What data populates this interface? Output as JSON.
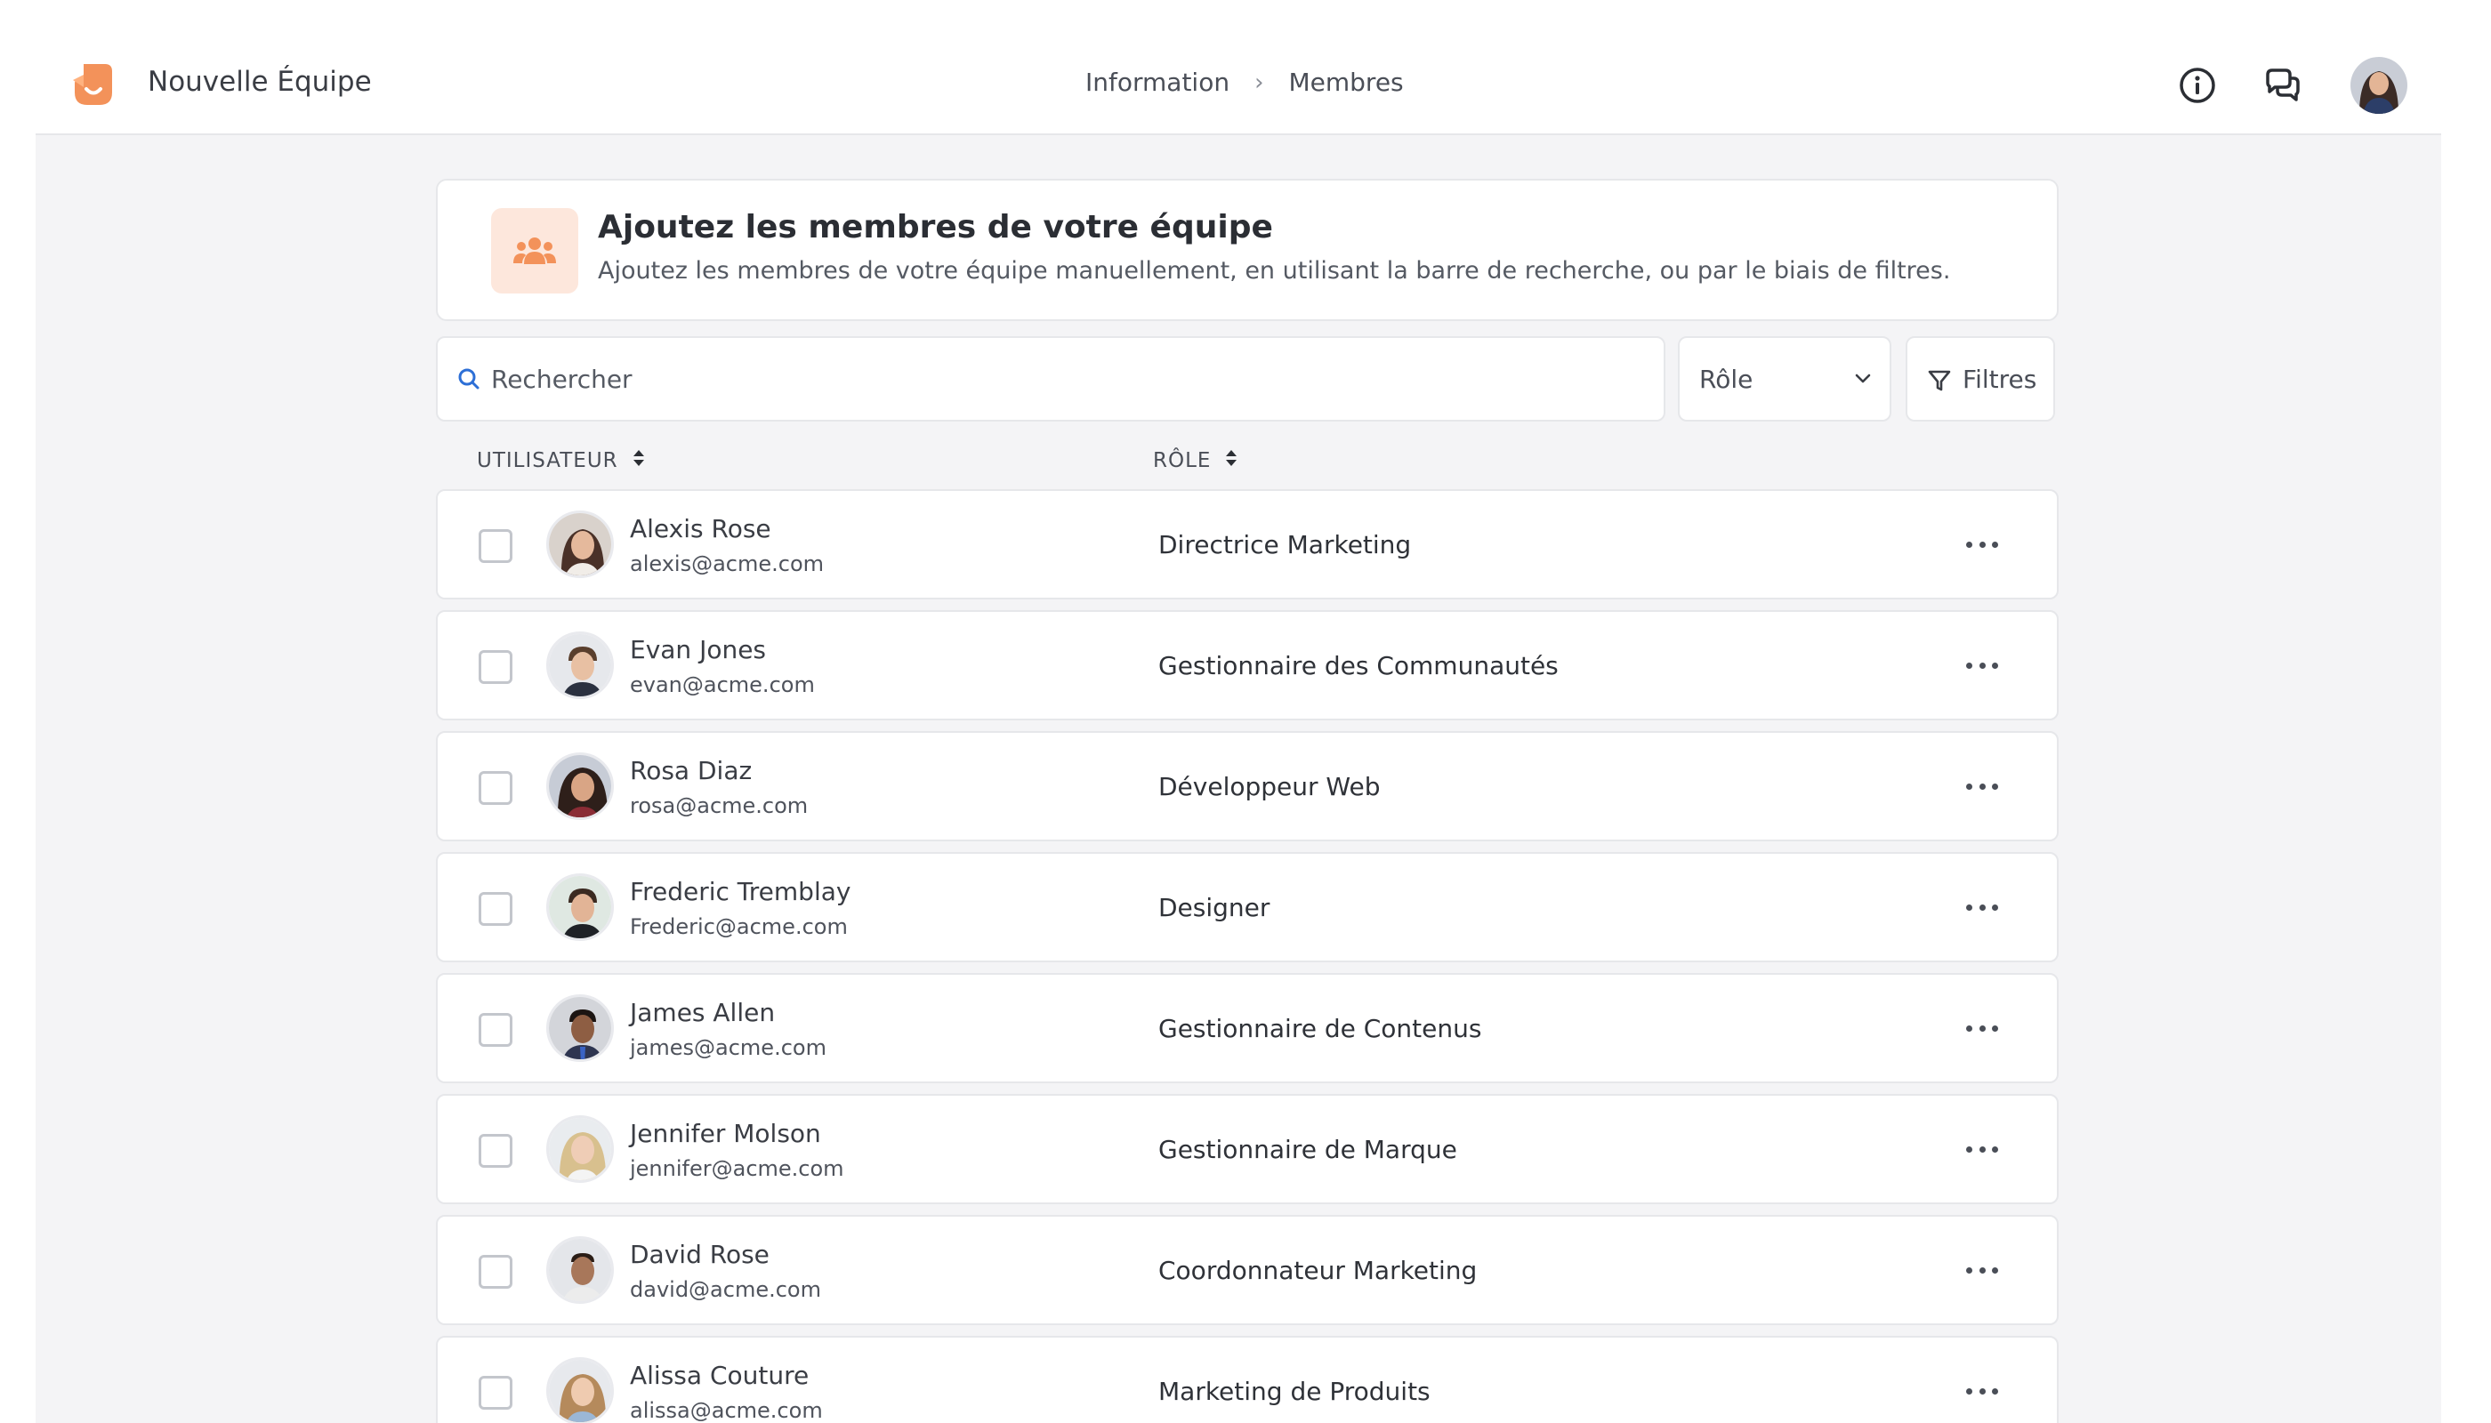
{
  "header": {
    "team_name": "Nouvelle Équipe",
    "breadcrumb": [
      "Information",
      "Membres"
    ],
    "icons": [
      "info-icon",
      "chat-icon",
      "user-avatar"
    ]
  },
  "intro": {
    "icon": "team-icon",
    "title": "Ajoutez les membres de votre équipe",
    "subtitle": "Ajoutez les membres de votre équipe manuellement, en utilisant la barre de recherche, ou par le biais de filtres."
  },
  "search": {
    "placeholder": "Rechercher"
  },
  "role_filter": {
    "label": "Rôle"
  },
  "filters": {
    "label": "Filtres"
  },
  "columns": {
    "user": "UTILISATEUR",
    "role": "RÔLE"
  },
  "members": [
    {
      "name": "Alexis Rose",
      "email": "alexis@acme.com",
      "role": "Directrice Marketing"
    },
    {
      "name": "Evan Jones",
      "email": "evan@acme.com",
      "role": "Gestionnaire des Communautés"
    },
    {
      "name": "Rosa Diaz",
      "email": "rosa@acme.com",
      "role": "Développeur Web"
    },
    {
      "name": "Frederic Tremblay",
      "email": "Frederic@acme.com",
      "role": "Designer"
    },
    {
      "name": "James Allen",
      "email": "james@acme.com",
      "role": "Gestionnaire de Contenus"
    },
    {
      "name": "Jennifer Molson",
      "email": "jennifer@acme.com",
      "role": "Gestionnaire de Marque"
    },
    {
      "name": "David Rose",
      "email": "david@acme.com",
      "role": "Coordonnateur Marketing"
    },
    {
      "name": "Alissa Couture",
      "email": "alissa@acme.com",
      "role": "Marketing de Produits"
    }
  ],
  "colors": {
    "accent": "#f3925a",
    "accent_bg": "#fde7dc",
    "search_icon": "#2d6fd6",
    "page_bg": "#f4f4f6",
    "border": "#e6e7ea"
  }
}
